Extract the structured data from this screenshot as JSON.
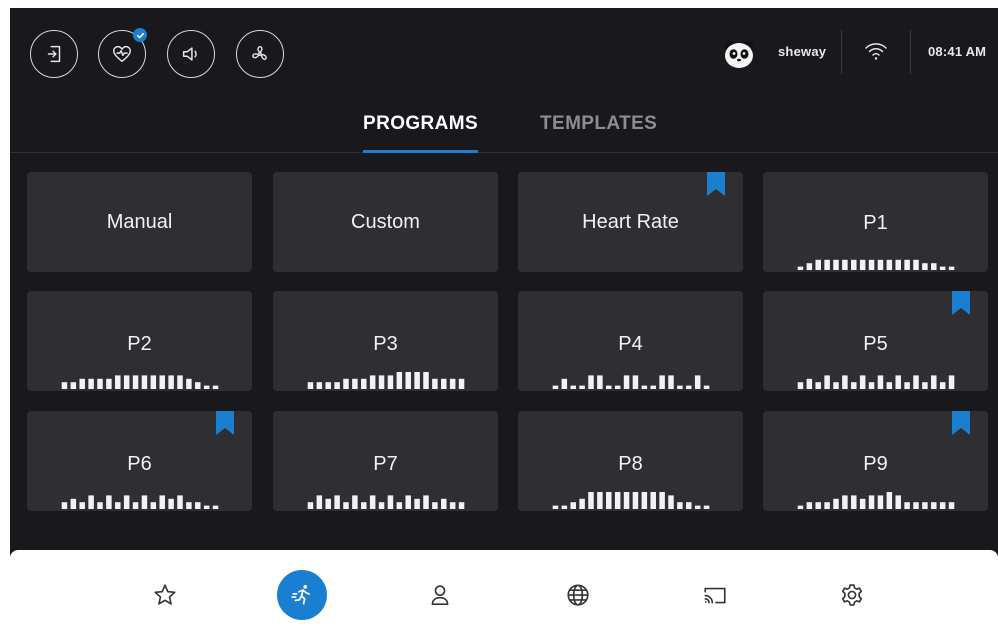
{
  "colors": {
    "screen_bg": "#19191d",
    "tile_bg": "#2e2e33",
    "accent": "#1a7fd0",
    "text": "#f2f2f4",
    "tab_inactive": "#8c8c93",
    "nav_bg": "#ffffff",
    "nav_icon": "#333338"
  },
  "topbar": {
    "buttons": [
      {
        "icon": "exit-icon"
      },
      {
        "icon": "heart-rate-icon",
        "badge": "check-icon"
      },
      {
        "icon": "speaker-icon"
      },
      {
        "icon": "fan-icon"
      }
    ],
    "user": {
      "name": "sheway",
      "avatar": "panda-avatar-icon"
    },
    "wifi_icon": "wifi-icon",
    "time": "08:41 AM"
  },
  "tabs": [
    {
      "label": "PROGRAMS",
      "active": true
    },
    {
      "label": "TEMPLATES",
      "active": false
    }
  ],
  "programs": [
    {
      "name": "Manual",
      "bookmarked": false,
      "profile": []
    },
    {
      "name": "Custom",
      "bookmarked": false,
      "profile": []
    },
    {
      "name": "Heart Rate",
      "bookmarked": true,
      "profile": []
    },
    {
      "name": "P1",
      "bookmarked": false,
      "profile": [
        1,
        2,
        3,
        3,
        3,
        3,
        3,
        3,
        3,
        3,
        3,
        3,
        3,
        3,
        2,
        2,
        1,
        1
      ]
    },
    {
      "name": "P2",
      "bookmarked": false,
      "profile": [
        2,
        2,
        3,
        3,
        3,
        3,
        4,
        4,
        4,
        4,
        4,
        4,
        4,
        4,
        3,
        2,
        1,
        1
      ]
    },
    {
      "name": "P3",
      "bookmarked": false,
      "profile": [
        2,
        2,
        2,
        2,
        3,
        3,
        3,
        4,
        4,
        4,
        5,
        5,
        5,
        5,
        3,
        3,
        3,
        3
      ]
    },
    {
      "name": "P4",
      "bookmarked": false,
      "profile": [
        1,
        3,
        1,
        1,
        4,
        4,
        1,
        1,
        4,
        4,
        1,
        1,
        4,
        4,
        1,
        1,
        4,
        1
      ]
    },
    {
      "name": "P5",
      "bookmarked": true,
      "profile": [
        2,
        3,
        2,
        4,
        2,
        4,
        2,
        4,
        2,
        4,
        2,
        4,
        2,
        4,
        2,
        4,
        2,
        4
      ]
    },
    {
      "name": "P6",
      "bookmarked": true,
      "profile": [
        2,
        3,
        2,
        4,
        2,
        4,
        2,
        4,
        2,
        4,
        2,
        4,
        3,
        4,
        2,
        2,
        1,
        1
      ]
    },
    {
      "name": "P7",
      "bookmarked": false,
      "profile": [
        2,
        4,
        3,
        4,
        2,
        4,
        2,
        4,
        2,
        4,
        2,
        4,
        3,
        4,
        2,
        3,
        2,
        2
      ]
    },
    {
      "name": "P8",
      "bookmarked": false,
      "profile": [
        1,
        1,
        2,
        3,
        5,
        5,
        5,
        5,
        5,
        5,
        5,
        5,
        5,
        4,
        2,
        2,
        1,
        1
      ]
    },
    {
      "name": "P9",
      "bookmarked": true,
      "profile": [
        1,
        2,
        2,
        2,
        3,
        4,
        4,
        3,
        4,
        4,
        5,
        4,
        2,
        2,
        2,
        2,
        2,
        2
      ]
    }
  ],
  "bottom_nav": [
    {
      "icon": "star-icon",
      "active": false
    },
    {
      "icon": "runner-icon",
      "active": true
    },
    {
      "icon": "user-icon",
      "active": false
    },
    {
      "icon": "globe-icon",
      "active": false
    },
    {
      "icon": "cast-icon",
      "active": false
    },
    {
      "icon": "settings-gear-icon",
      "active": false
    }
  ]
}
